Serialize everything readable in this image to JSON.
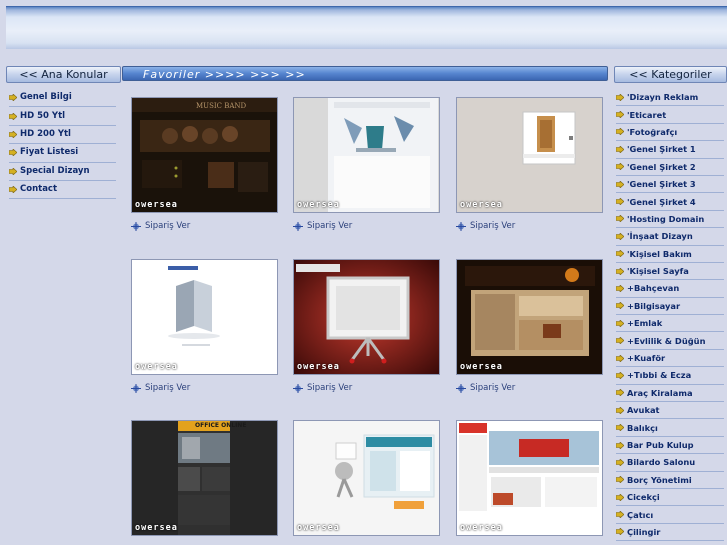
{
  "headers": {
    "left": "<< Ana Konular",
    "middle": "Favoriler  >>>> >>> >>",
    "right": "<< Kategoriler"
  },
  "left_nav": [
    "Genel Bilgi",
    "HD 50 Ytl",
    "HD 200 Ytl",
    "Fiyat Listesi",
    "Special Dizayn",
    "Contact"
  ],
  "right_nav": [
    "'Dizayn Reklam",
    "'Eticaret",
    "'Fotoğrafçı",
    "'Genel Şirket 1",
    "'Genel Şirket 2",
    "'Genel Şirket 3",
    "'Genel Şirket 4",
    "'Hosting Domain",
    "'İnşaat Dizayn",
    "'Kişisel Bakım",
    "'Kişisel Sayfa",
    "+Bahçevan",
    "+Bilgisayar",
    "+Emlak",
    "+Evlilik & Düğün",
    "+Kuaför",
    "+Tıbbi & Ecza",
    "Araç Kiralama",
    "Avukat",
    "Balıkçı",
    "Bar Pub Kulup",
    "Bilardo Salonu",
    "Borç Yönetimi",
    "Cicekçi",
    "Çatıcı",
    "Çilingir"
  ],
  "thumbnails": {
    "watermark": "owersea",
    "order_label": "Sipariş Ver",
    "t1_title": "MUSIC BAND",
    "t7_title": "OFFICE  ONLINE"
  },
  "colors": {
    "page_bg": "#d4d8e9",
    "nav_text": "#0f2a6b",
    "order_text": "#2a3f7a"
  }
}
